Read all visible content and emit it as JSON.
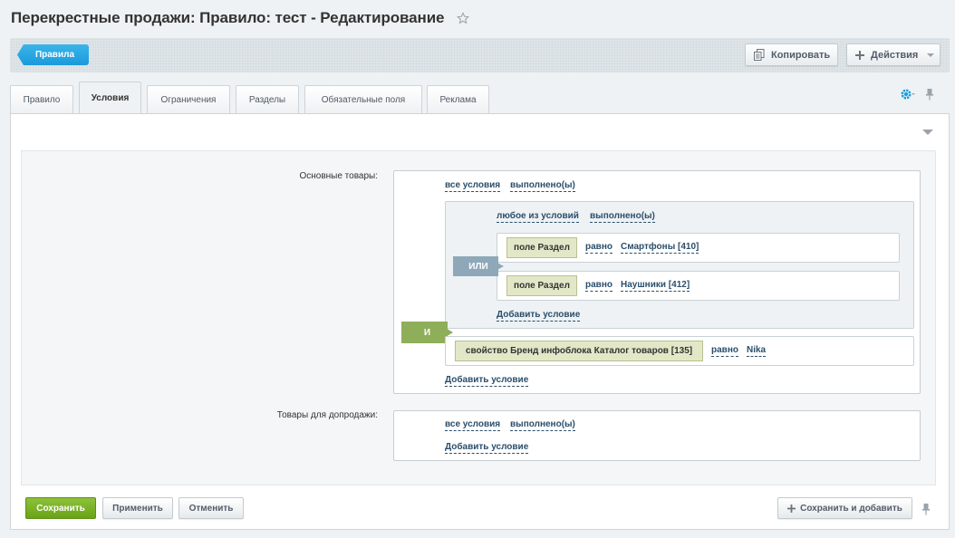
{
  "page": {
    "title": "Перекрестные продажи: Правило: тест - Редактирование",
    "favorite_icon": "star-icon"
  },
  "toolbar": {
    "back_label": "Правила",
    "copy_label": "Копировать",
    "copy_icon": "copy-icon",
    "actions_label": "Действия",
    "actions_icon": "plus-icon"
  },
  "tabs": [
    {
      "label": "Правило",
      "active": false
    },
    {
      "label": "Условия",
      "active": true
    },
    {
      "label": "Ограничения",
      "active": false
    },
    {
      "label": "Разделы",
      "active": false
    },
    {
      "label": "Обязательные поля",
      "active": false
    },
    {
      "label": "Реклама",
      "active": false
    }
  ],
  "main_goods": {
    "label": "Основные товары:",
    "all_conditions": "все условия",
    "fulfilled": "выполнено(ы)",
    "and_badge": "И",
    "group": {
      "any_conditions": "любое из условий",
      "fulfilled": "выполнено(ы)",
      "or_badge": "ИЛИ",
      "rows": [
        {
          "field": "поле Раздел",
          "op": "равно",
          "value": "Смартфоны [410]"
        },
        {
          "field": "поле Раздел",
          "op": "равно",
          "value": "Наушники [412]"
        }
      ],
      "add_condition": "Добавить условие"
    },
    "brand_row": {
      "field": "свойство Бренд инфоблока Каталог товаров [135]",
      "op": "равно",
      "value": "Nika"
    },
    "add_condition": "Добавить условие"
  },
  "upsell_goods": {
    "label": "Товары для допродажи:",
    "all_conditions": "все условия",
    "fulfilled": "выполнено(ы)",
    "add_condition": "Добавить условие"
  },
  "footer": {
    "save": "Сохранить",
    "apply": "Применить",
    "cancel": "Отменить",
    "save_and_add": "Сохранить и добавить"
  },
  "colors": {
    "accent_blue": "#1a9adc",
    "save_green": "#6aa317",
    "or_badge": "#8ea8b9",
    "and_badge": "#8fae5a",
    "field_tag": "#e2e8c7"
  }
}
